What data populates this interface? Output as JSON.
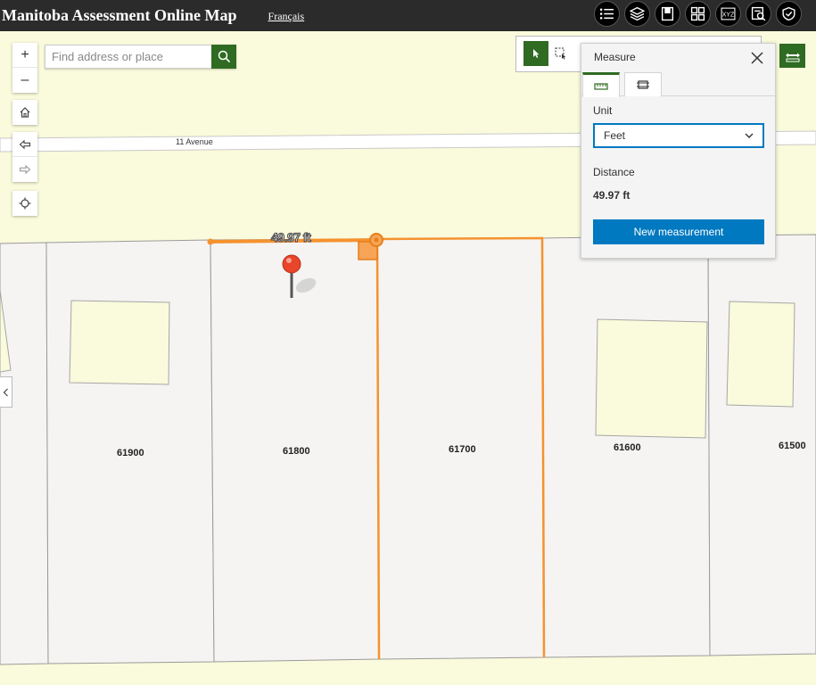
{
  "header": {
    "title": "Manitoba Assessment Online Map",
    "language_link": "Français",
    "tools": [
      {
        "icon": "list-icon"
      },
      {
        "icon": "layers-icon"
      },
      {
        "icon": "bookmark-icon"
      },
      {
        "icon": "basemap-gallery-icon"
      },
      {
        "icon": "xyz-coordinate-icon"
      },
      {
        "icon": "search-report-icon"
      },
      {
        "icon": "shield-locate-icon"
      }
    ],
    "xyz_text": "XYZ"
  },
  "search": {
    "placeholder": "Find address or place"
  },
  "map": {
    "street_label": "11 Avenue",
    "lots": [
      "61900",
      "61800",
      "61700",
      "61600",
      "61500"
    ],
    "measurement_label": "49.97 ft"
  },
  "controls": {
    "zoom_in": "+",
    "zoom_out": "–"
  },
  "measure_panel": {
    "title": "Measure",
    "unit_label": "Unit",
    "unit_value": "Feet",
    "distance_label": "Distance",
    "distance_value": "49.97 ft",
    "new_button": "New measurement"
  },
  "colors": {
    "header_bg": "#2b2b2b",
    "accent_green": "#2f6b22",
    "accent_blue": "#0079c1",
    "measure_orange": "#f5922f",
    "parcel_fill": "#f5f4f2",
    "map_bg": "#fafadc"
  }
}
